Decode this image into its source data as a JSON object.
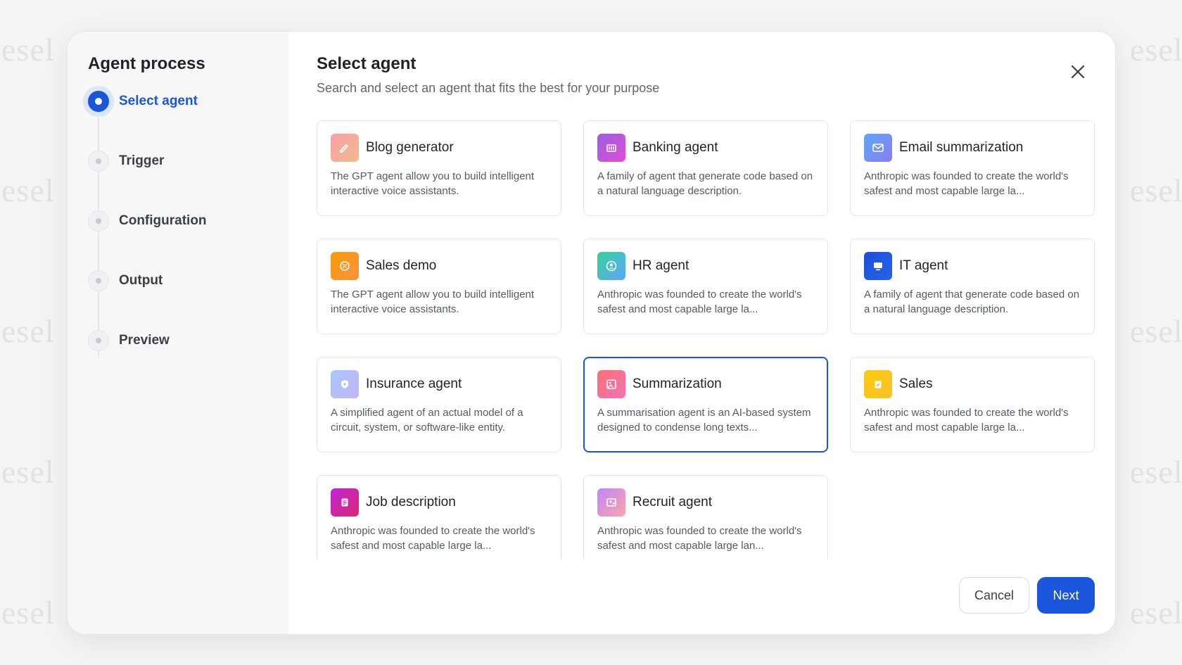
{
  "watermark": "esel",
  "sidebar": {
    "title": "Agent process",
    "steps": [
      {
        "label": "Select agent",
        "active": true
      },
      {
        "label": "Trigger",
        "active": false
      },
      {
        "label": "Configuration",
        "active": false
      },
      {
        "label": "Output",
        "active": false
      },
      {
        "label": "Preview",
        "active": false
      }
    ]
  },
  "main": {
    "title": "Select agent",
    "subtitle": "Search and select an agent that fits the best for your purpose"
  },
  "agents": [
    {
      "title": "Blog generator",
      "desc": "The GPT agent allow you to build intelligent interactive voice assistants.",
      "icon": "pen-icon",
      "colors": [
        "#f7a0a8",
        "#f3b98c"
      ]
    },
    {
      "title": "Banking agent",
      "desc": "A family of agent that generate code based on a natural language description.",
      "icon": "bank-icon",
      "colors": [
        "#9b5de5",
        "#e14fd2"
      ]
    },
    {
      "title": "Email summarization",
      "desc": "Anthropic was founded to create the world's safest and most capable large la...",
      "icon": "mail-icon",
      "colors": [
        "#5ea8f5",
        "#8a7cf2"
      ]
    },
    {
      "title": "Sales demo",
      "desc": "The GPT agent allow you to build intelligent interactive voice assistants.",
      "icon": "percent-icon",
      "colors": [
        "#f59e0b",
        "#fb923c"
      ]
    },
    {
      "title": "HR agent",
      "desc": "Anthropic was founded to create the world's safest and most capable large la...",
      "icon": "user-icon",
      "colors": [
        "#34d399",
        "#60a5fa"
      ]
    },
    {
      "title": "IT agent",
      "desc": "A family of agent that generate code based on a natural language description.",
      "icon": "monitor-icon",
      "colors": [
        "#1d4ed8",
        "#2563eb"
      ]
    },
    {
      "title": "Insurance agent",
      "desc": "A simplified agent of an actual model of a circuit, system, or software-like entity.",
      "icon": "shield-icon",
      "colors": [
        "#a7c7f7",
        "#c4b5fd"
      ]
    },
    {
      "title": "Summarization",
      "desc": "A summarisation agent is an AI-based system designed to condense long texts...",
      "icon": "image-icon",
      "colors": [
        "#f87171",
        "#f472b6"
      ],
      "selected": true
    },
    {
      "title": "Sales",
      "desc": "Anthropic was founded to create the world's safest and most capable large la...",
      "icon": "clipboard-icon",
      "colors": [
        "#facc15",
        "#fbbf24"
      ]
    },
    {
      "title": "Job description",
      "desc": "Anthropic was founded to create the world's safest and most capable large la...",
      "icon": "document-icon",
      "colors": [
        "#c026d3",
        "#db2777"
      ]
    },
    {
      "title": "Recruit agent",
      "desc": "Anthropic was founded to create the world's safest and most capable large lan...",
      "icon": "recruit-icon",
      "colors": [
        "#c084fc",
        "#fca5a5"
      ]
    }
  ],
  "footer": {
    "cancel_label": "Cancel",
    "next_label": "Next"
  },
  "colors": {
    "accent": "#1a56db"
  }
}
